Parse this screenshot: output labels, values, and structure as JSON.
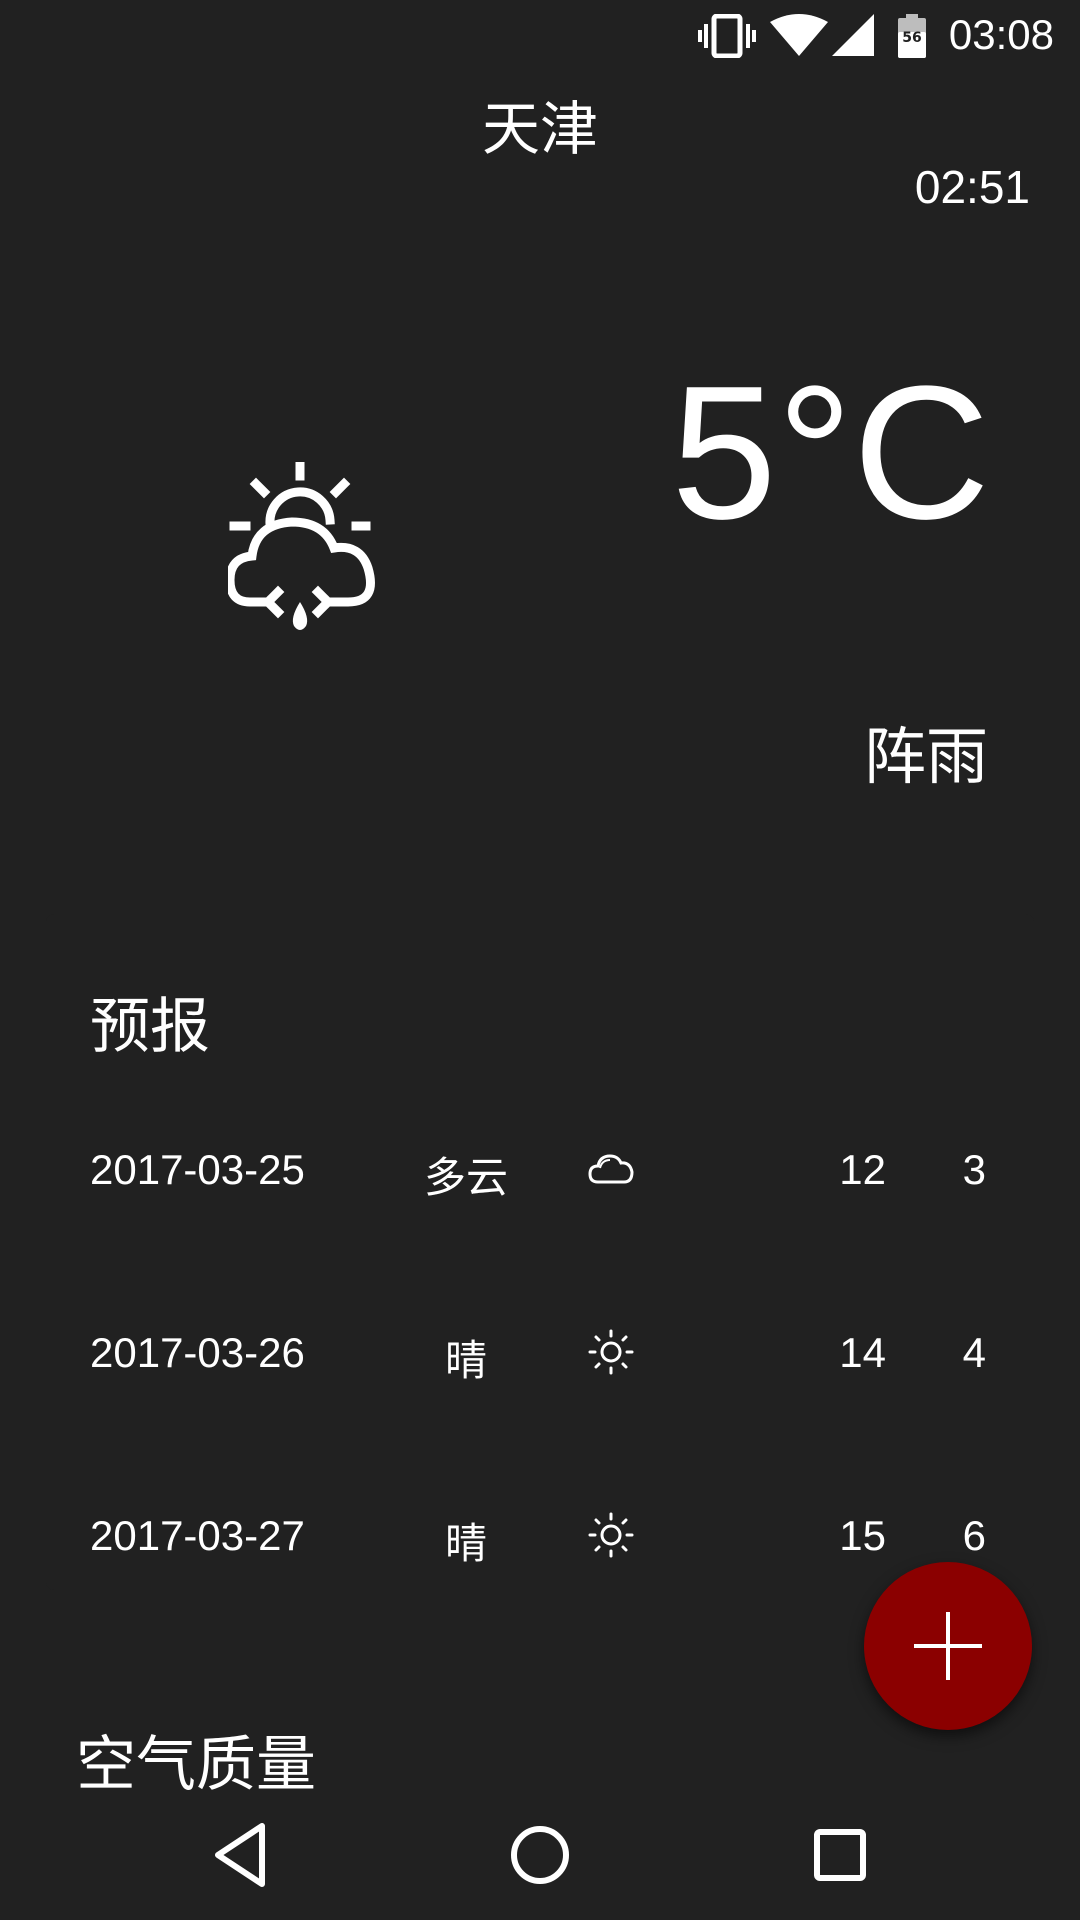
{
  "status_bar": {
    "time": "03:08",
    "battery_level": "56",
    "icons": [
      "vibrate-icon",
      "wifi-icon",
      "signal-icon",
      "battery-icon"
    ]
  },
  "header": {
    "city": "天津",
    "update_time": "02:51"
  },
  "current": {
    "temperature": "5°C",
    "condition": "阵雨",
    "icon": "shower-rain-icon"
  },
  "forecast": {
    "title": "预报",
    "rows": [
      {
        "date": "2017-03-25",
        "condition": "多云",
        "icon": "cloud-icon",
        "high": "12",
        "low": "3"
      },
      {
        "date": "2017-03-26",
        "condition": "晴",
        "icon": "sun-icon",
        "high": "14",
        "low": "4"
      },
      {
        "date": "2017-03-27",
        "condition": "晴",
        "icon": "sun-icon",
        "high": "15",
        "low": "6"
      }
    ]
  },
  "air_quality": {
    "title": "空气质量"
  },
  "fab": {
    "icon": "plus-icon",
    "color": "#8b0000"
  },
  "colors": {
    "background": "#212121",
    "text": "#ffffff",
    "accent": "#8b0000"
  },
  "nav_bar": {
    "buttons": [
      "back-icon",
      "home-icon",
      "recents-icon"
    ]
  }
}
